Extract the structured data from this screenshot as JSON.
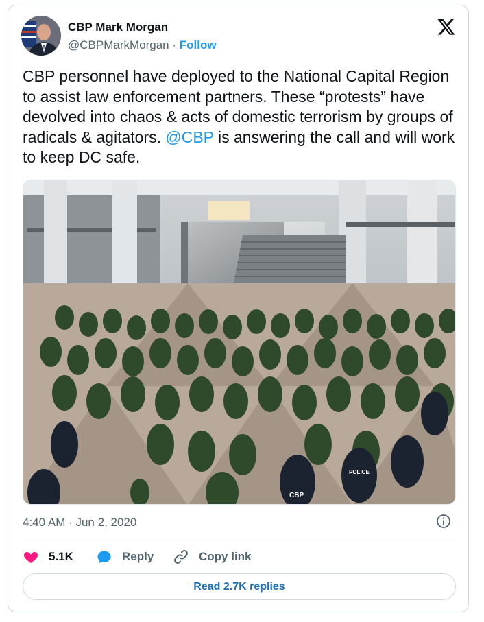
{
  "author": {
    "name": "CBP Mark Morgan",
    "handle": "@CBPMarkMorgan",
    "separator": "·",
    "follow_label": "Follow"
  },
  "tweet": {
    "text_before": "CBP personnel have deployed to the National Capital Region to assist law enforcement partners. These “protests” have devolved into chaos & acts of domestic terrorism by groups of radicals & agitators. ",
    "mention": "@CBP",
    "text_after": " is answering the call and will work to keep DC safe.",
    "timestamp": "4:40 AM · Jun 2, 2020"
  },
  "photo": {
    "vest_label_police": "POLICE",
    "vest_label_cbp": "CBP"
  },
  "actions": {
    "like_count": "5.1K",
    "reply_label": "Reply",
    "copy_link_label": "Copy link"
  },
  "read_replies_label": "Read 2.7K replies",
  "colors": {
    "accent": "#1d9bf0",
    "like": "#f91880",
    "uniform_green": "#2f4a2a",
    "text_secondary": "#536471"
  }
}
